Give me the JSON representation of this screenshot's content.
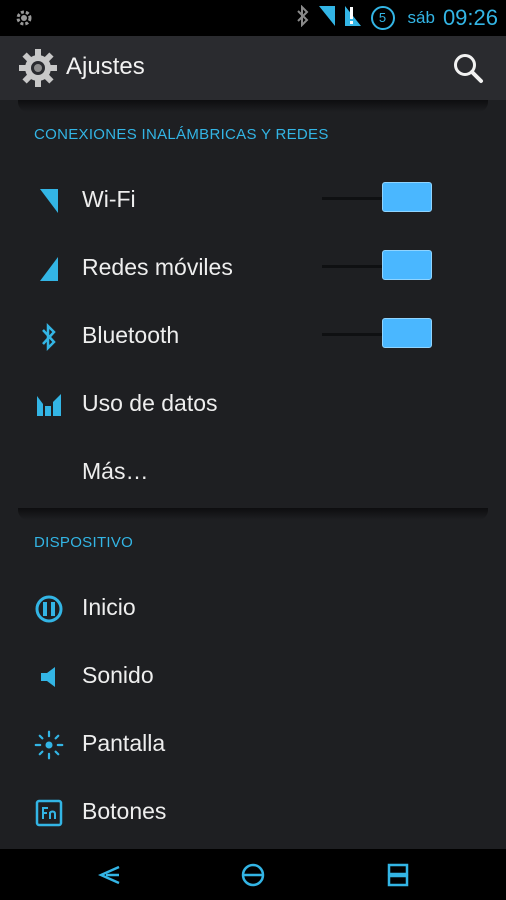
{
  "status_bar": {
    "day": "sáb",
    "time": "09:26",
    "notification_icon": "settings-gear-icon",
    "indicators": [
      "bluetooth-icon",
      "wifi-signal-icon",
      "cell-signal-icon",
      "battery-icon"
    ],
    "battery_level": "5"
  },
  "action_bar": {
    "title": "Ajustes",
    "app_icon": "settings-gear-icon",
    "search_icon": "search-icon"
  },
  "sections": {
    "wireless": {
      "header": "CONEXIONES INALÁMBRICAS Y REDES",
      "items": [
        {
          "label": "Wi-Fi",
          "icon": "wifi-icon",
          "toggle_on": true
        },
        {
          "label": "Redes móviles",
          "icon": "mobile-signal-icon",
          "toggle_on": true
        },
        {
          "label": "Bluetooth",
          "icon": "bluetooth-icon",
          "toggle_on": true
        },
        {
          "label": "Uso de datos",
          "icon": "data-usage-icon"
        },
        {
          "label": "Más…"
        }
      ]
    },
    "device": {
      "header": "DISPOSITIVO",
      "items": [
        {
          "label": "Inicio",
          "icon": "home-icon"
        },
        {
          "label": "Sonido",
          "icon": "speaker-icon"
        },
        {
          "label": "Pantalla",
          "icon": "brightness-icon"
        },
        {
          "label": "Botones",
          "icon": "fn-key-icon"
        }
      ]
    }
  },
  "nav_bar": {
    "back": "back-icon",
    "home": "home-icon",
    "recents": "recents-icon"
  },
  "colors": {
    "accent": "#33b5e5",
    "toggle": "#4ab7ff",
    "background": "#1e1f22",
    "action_bar": "#2a2b2f"
  }
}
